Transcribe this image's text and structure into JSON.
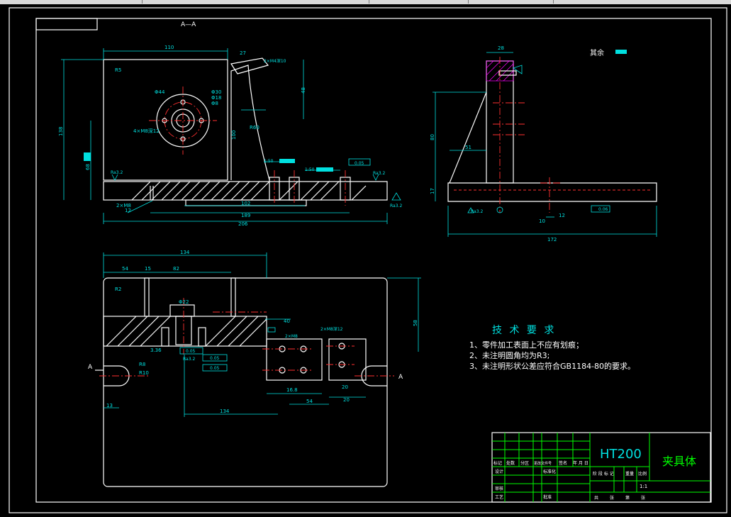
{
  "section": {
    "title": "A—A",
    "view_label_left": "A",
    "view_label_right": "A"
  },
  "surface_note": "其余",
  "tech": {
    "heading": "技 术 要 求",
    "items": [
      "1、零件加工表面上不应有划痕；",
      "2、未注明圆角均为R3;",
      "3、未注明形状公差应符合GB1184-80的要求。"
    ]
  },
  "title_block": {
    "material": "HT200",
    "part_name": "夹具体",
    "scale": "1:1",
    "row_labels": [
      "标记",
      "处数",
      "分区",
      "更改文件号",
      "签名",
      "年 月 日"
    ],
    "left_labels": [
      "设计",
      "标准化",
      "审核",
      "工艺",
      "批准"
    ],
    "mid_labels": [
      "阶 段 标 记",
      "重量",
      "比例"
    ],
    "bottom_labels": [
      "共",
      "张",
      "第",
      "张"
    ]
  },
  "dims_front": [
    "110",
    "R5",
    "27",
    "20",
    "2×M4深10",
    "48",
    "Φ44",
    "Φ30",
    "Φ18",
    "Φ8",
    "4×M8深12",
    "31",
    "100",
    "R60",
    "138",
    "68",
    "Ra3.2",
    "1:50",
    "1:50",
    "0.05",
    "2×M8",
    "12",
    "102",
    "189",
    "206",
    "Ra3.2",
    "Ra3.2",
    "Ra3.2"
  ],
  "dims_side": [
    "28",
    "80",
    "51",
    "17",
    "172",
    "10",
    "12",
    "0.06",
    "Ra3.2"
  ],
  "dims_top": [
    "134",
    "54",
    "15",
    "82",
    "R2",
    "Φ22",
    "40",
    "2×M8",
    "2×M8深12",
    "58",
    "20",
    "16.8",
    "R10",
    "R8",
    "13",
    "134",
    "54",
    "20",
    "3.36",
    "Ra3.2",
    "0.05",
    "0.05",
    "0.05"
  ]
}
